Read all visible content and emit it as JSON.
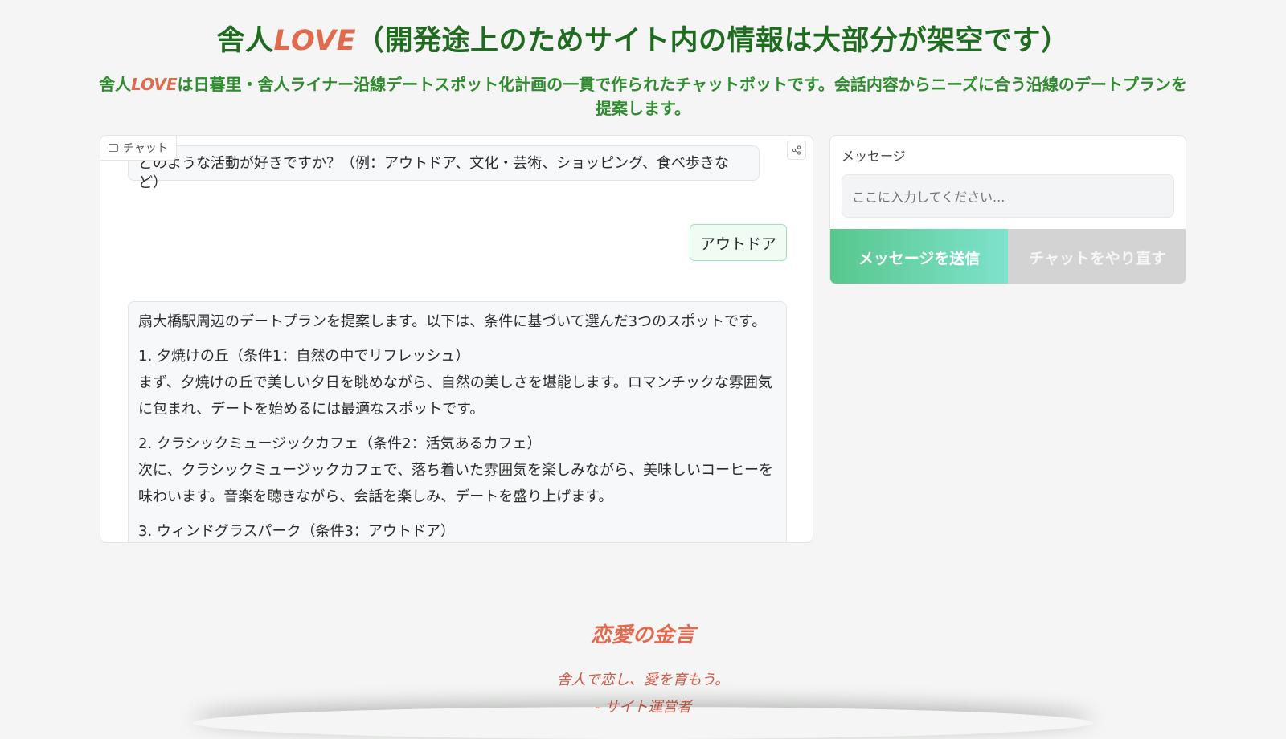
{
  "header": {
    "title_prefix": "舎人",
    "title_love": "LOVE",
    "title_suffix": "（開発途上のためサイト内の情報は大部分が架空です）",
    "subtitle_prefix": "舎人",
    "subtitle_love": "LOVE",
    "subtitle_suffix": "は日暮里・舎人ライナー沿線デートスポット化計画の一貫で作られたチャットボットです。会話内容からニーズに合う沿線のデートプランを提案します。"
  },
  "chat": {
    "label": "チャット",
    "messages": [
      {
        "role": "bot",
        "text": "どのような活動が好きですか？（例：アウトドア、文化・芸術、ショッピング、食べ歩きなど）"
      },
      {
        "role": "user",
        "text": "アウトドア"
      },
      {
        "role": "bot",
        "paragraphs": [
          "扇大橋駅周辺のデートプランを提案します。以下は、条件に基づいて選んだ3つのスポットです。",
          "1. 夕焼けの丘（条件1：自然の中でリフレッシュ）",
          "まず、夕焼けの丘で美しい夕日を眺めながら、自然の美しさを堪能します。ロマンチックな雰囲気に包まれ、デートを始めるには最適なスポットです。",
          "2. クラシックミュージックカフェ（条件2：活気あるカフェ）",
          "次に、クラシックミュージックカフェで、落ち着いた雰囲気を楽しみながら、美味しいコーヒーを味わいます。音楽を聴きながら、会話を楽しみ、デートを盛り上げます。",
          "3. ウィンドグラスパーク（条件3：アウトドア）"
        ]
      }
    ]
  },
  "input": {
    "label": "メッセージ",
    "placeholder": "ここに入力してください..."
  },
  "buttons": {
    "send": "メッセージを送信",
    "retry": "チャットをやり直す"
  },
  "quote": {
    "title": "恋愛の金言",
    "text": "舎人で恋し、愛を育もう。",
    "author": "- サイト運営者"
  },
  "colors": {
    "title_green": "#1f6b1f",
    "subtitle_green": "#2e8b2e",
    "love_accent": "#e06a4e",
    "send_gradient_start": "#58c78e",
    "send_gradient_end": "#7ee2cc",
    "retry_gray": "#d3d3d3"
  }
}
